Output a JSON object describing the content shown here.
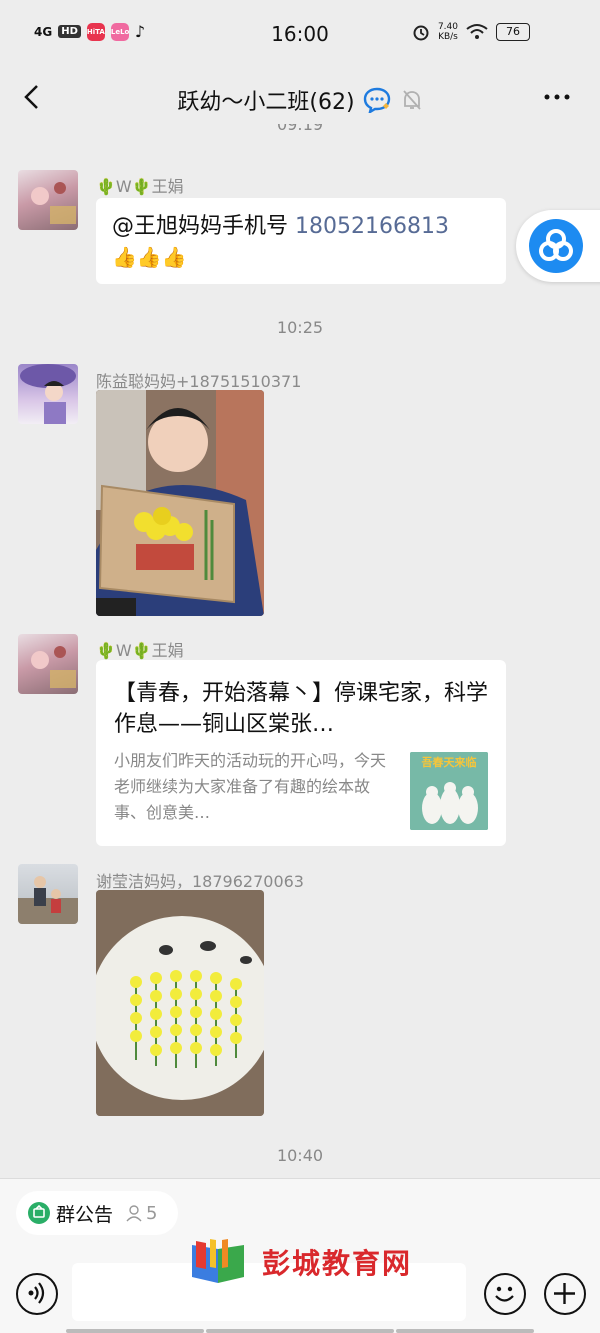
{
  "status_bar": {
    "network": "4G",
    "hd": "HD",
    "app1": "HiTA",
    "app2": "LeLo",
    "time": "16:00",
    "speed_value": "7.40",
    "speed_unit": "KB/s",
    "battery": "76"
  },
  "header": {
    "title": "跃幼～小二班(62)"
  },
  "timestamps": {
    "partial": "09:19",
    "t1": "10:25",
    "t2": "10:40"
  },
  "messages": [
    {
      "sender": "🌵W🌵王娟",
      "text_prefix": "@王旭妈妈手机号 ",
      "phone": "18052166813",
      "emojis": "👍👍👍"
    },
    {
      "sender": "陈益聪妈妈+18751510371"
    },
    {
      "sender": "🌵W🌵王娟",
      "card_title": "【青春，开始落幕丶】停课宅家，科学作息——铜山区棠张…",
      "card_desc": "小朋友们昨天的活动玩的开心吗，今天老师继续为大家准备了有趣的绘本故事、创意美…",
      "card_thumb_text": "吾春天来临"
    },
    {
      "sender": "谢莹洁妈妈，18796270063"
    }
  ],
  "bottom": {
    "notice_label": "群公告",
    "notice_count": "5",
    "watermark": "彭城教育网"
  },
  "colors": {
    "background": "#ededed",
    "link": "#576b95",
    "notice_green": "#2aae67",
    "watermark_red": "#d9282c"
  }
}
